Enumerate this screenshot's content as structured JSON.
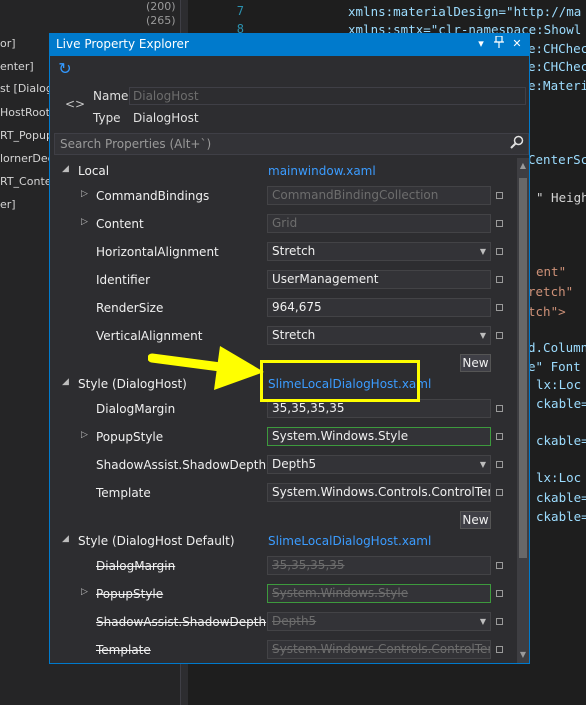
{
  "background": {
    "left_panel_rows": [
      "or]",
      "enter]",
      "st [DialogH",
      "HostRoot",
      "RT_Popup",
      "lornerDec",
      "RT_Conter",
      "er]"
    ],
    "counts": [
      "(200)",
      "(265)"
    ],
    "line_numbers": [
      "7",
      "8"
    ],
    "code_lines": [
      "xmlns:materialDesign=\"http://ma",
      "xmlns:smtx=\"clr-namespace:Showl",
      "e:CHCheck",
      "e:CHCheck",
      "e:Materia",
      "CenterSc",
      "\" Height",
      "ent\"",
      "retch\"",
      "tch\">",
      "d.Column",
      "e\" Font",
      "lx:Loc M",
      "ckable=",
      "ckable=",
      "lx:Loc M",
      "ckable=",
      "ckable="
    ]
  },
  "window": {
    "title": "Live Property Explorer",
    "refresh_icon": "refresh-icon",
    "name_label": "Name",
    "name_value": "DialogHost",
    "type_label": "Type",
    "type_value": "DialogHost",
    "search_placeholder": "Search Properties (Alt+`)"
  },
  "sections": {
    "local": {
      "name": "Local",
      "source": "mainwindow.xaml",
      "props": [
        {
          "name": "CommandBindings",
          "value": "CommandBindingCollection",
          "expandable": true,
          "dim": true
        },
        {
          "name": "Content",
          "value": "Grid",
          "expandable": true,
          "dim": true
        },
        {
          "name": "HorizontalAlignment",
          "value": "Stretch",
          "dropdown": true
        },
        {
          "name": "Identifier",
          "value": "UserManagement"
        },
        {
          "name": "RenderSize",
          "value": "964,675"
        },
        {
          "name": "VerticalAlignment",
          "value": "Stretch",
          "dropdown": true
        }
      ],
      "new_label": "New"
    },
    "style": {
      "name": "Style (DialogHost)",
      "source": "SlimeLocalDialogHost.xaml",
      "props": [
        {
          "name": "DialogMargin",
          "value": "35,35,35,35"
        },
        {
          "name": "PopupStyle",
          "value": "System.Windows.Style",
          "expandable": true,
          "green": true
        },
        {
          "name": "ShadowAssist.ShadowDepth",
          "value": "Depth5",
          "dropdown": true
        },
        {
          "name": "Template",
          "value": "System.Windows.Controls.ControlTempla"
        }
      ],
      "new_label": "New"
    },
    "style_default": {
      "name": "Style (DialogHost Default)",
      "source": "SlimeLocalDialogHost.xaml",
      "props": [
        {
          "name": "DialogMargin",
          "value": "35,35,35,35"
        },
        {
          "name": "PopupStyle",
          "value": "System.Windows.Style",
          "expandable": true,
          "green": true
        },
        {
          "name": "ShadowAssist.ShadowDepth",
          "value": "Depth5",
          "dropdown": true
        },
        {
          "name": "Template",
          "value": "System.Windows.Controls.ControlTempla"
        }
      ]
    }
  },
  "colors": {
    "accent": "#007acc",
    "link": "#3b9cff",
    "highlight": "#ffff00"
  }
}
